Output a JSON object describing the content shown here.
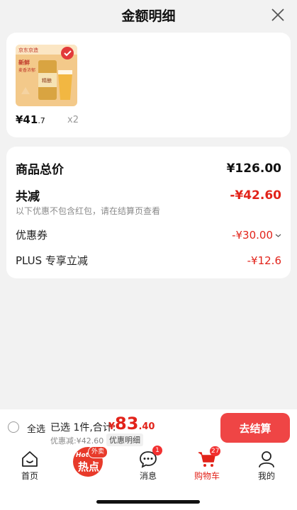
{
  "header": {
    "title": "金额明细"
  },
  "product": {
    "price_int": "¥41",
    "price_dec": ".7",
    "qty": "x2",
    "image_text": {
      "brand": "京东京造",
      "tag1": "新鲜",
      "tag2": "麦香浓郁",
      "can": "精酿"
    }
  },
  "summary": {
    "total_label": "商品总价",
    "total_value": "¥126.00",
    "reduce_label": "共减",
    "reduce_value": "-¥42.60",
    "note": "以下优惠不包含红包，请在结算页查看",
    "coupon_label": "优惠券",
    "coupon_value": "-¥30.00",
    "plus_label": "PLUS 专享立减",
    "plus_value": "-¥12.6"
  },
  "footer": {
    "select_all": "全选",
    "selected": "已选 1件,合计:",
    "total_cur": "¥",
    "total_int": "83",
    "total_dec": ".40",
    "discount": "优惠减:¥42.60",
    "detail": "优惠明细",
    "checkout": "去结算"
  },
  "tabbar": {
    "home": "首页",
    "hot_en": "Hot",
    "hot_cn": "热点",
    "hot_badge": "外卖",
    "messages": "消息",
    "messages_badge": "1",
    "cart": "购物车",
    "cart_badge": "27",
    "me": "我的"
  },
  "colors": {
    "accent": "#e2231a",
    "checkout": "#ef4545",
    "background": "#f2f2f2"
  },
  "icons": [
    "close-icon",
    "home-icon",
    "message-icon",
    "cart-icon",
    "user-icon"
  ]
}
